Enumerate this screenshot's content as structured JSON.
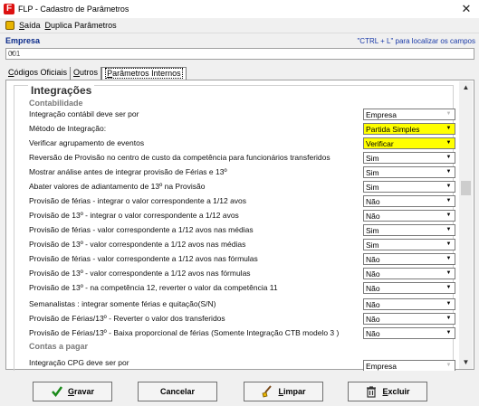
{
  "window": {
    "title": "FLP - Cadastro de Parâmetros",
    "logo": "F"
  },
  "menu": {
    "items": [
      {
        "first": "S",
        "rest": "aída"
      },
      {
        "first": "D",
        "rest": "uplica Parâmetros"
      }
    ]
  },
  "empresa": {
    "label": "Empresa",
    "hint": "\"CTRL + L\" para localizar os campos",
    "value": "001"
  },
  "tabs": {
    "items": [
      {
        "first": "C",
        "rest": "ódigos Oficiais"
      },
      {
        "first": "O",
        "rest": "utros"
      },
      {
        "first": "P",
        "rest": "arâmetros Internos"
      }
    ]
  },
  "content": {
    "section_title": "Integrações",
    "group_contabilidade": "Contabilidade",
    "group_contas_pagar": "Contas a pagar",
    "rows": [
      {
        "label": "Integração contábil deve ser por",
        "value": "Empresa",
        "highlight": false,
        "dim": true
      },
      {
        "label": "Método de Integração:",
        "value": "Partida Simples",
        "highlight": true,
        "dim": false
      },
      {
        "label": "Verificar agrupamento de eventos",
        "value": "Verificar",
        "highlight": true,
        "dim": false
      },
      {
        "label": "Reversão de Provisão no centro de custo da competência para funcionários transferidos",
        "value": "Sim",
        "highlight": false,
        "dim": false
      },
      {
        "label": "Mostrar análise antes de integrar provisão de Férias e 13º",
        "value": "Sim",
        "highlight": false,
        "dim": false
      },
      {
        "label": "Abater valores de adiantamento  de 13º na Provisão",
        "value": "Sim",
        "highlight": false,
        "dim": false
      },
      {
        "label": "Provisão de férias - integrar o valor correspondente a 1/12 avos",
        "value": "Não",
        "highlight": false,
        "dim": false
      },
      {
        "label": "Provisão de 13º - integrar o valor correspondente a 1/12 avos",
        "value": "Não",
        "highlight": false,
        "dim": false
      },
      {
        "label": "Provisão de férias - valor correspondente a 1/12 avos nas médias",
        "value": "Sim",
        "highlight": false,
        "dim": false
      },
      {
        "label": "Provisão de 13º - valor correspondente a 1/12 avos nas médias",
        "value": "Sim",
        "highlight": false,
        "dim": false
      },
      {
        "label": "Provisão de férias - valor correspondente a 1/12 avos nas fórmulas",
        "value": "Não",
        "highlight": false,
        "dim": false
      },
      {
        "label": "Provisão de 13º - valor correspondente a 1/12 avos nas fórmulas",
        "value": "Não",
        "highlight": false,
        "dim": false
      },
      {
        "label": "Provisão de 13º - na competência 12, reverter o valor da competência 11",
        "value": "Não",
        "highlight": false,
        "dim": false
      },
      {
        "label": "Semanalistas : integrar somente férias e quitação(S/N)",
        "value": "Não",
        "highlight": false,
        "dim": false
      },
      {
        "label": "Provisão de Férias/13º - Reverter o valor dos transferidos",
        "value": "Não",
        "highlight": false,
        "dim": false
      },
      {
        "label": "Provisão de Férias/13º - Baixa proporcional de férias (Somente Integração CTB modelo 3 )",
        "value": "Não",
        "highlight": false,
        "dim": false
      }
    ],
    "cpg_row": {
      "label": "Integração CPG deve ser por",
      "value": "Empresa"
    }
  },
  "footer": {
    "gravar": {
      "first": "G",
      "rest": "ravar"
    },
    "cancelar": "Cancelar",
    "limpar": {
      "first": "L",
      "rest": "impar"
    },
    "excluir": {
      "first": "E",
      "rest": "xcluir"
    }
  },
  "colors": {
    "highlight": "#ffff00",
    "empresa_label": "#0a2a8a",
    "hint": "#1a3aa8",
    "logo": "#dd1111"
  }
}
